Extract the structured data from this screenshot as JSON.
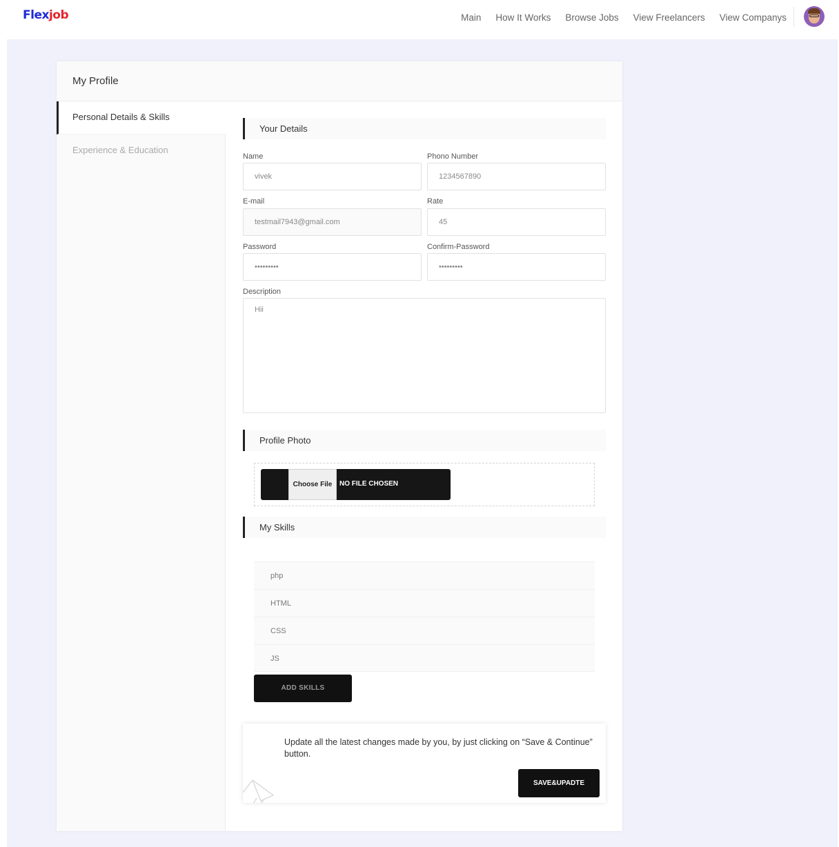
{
  "brand": {
    "part1": "Flex",
    "part2": "job"
  },
  "nav": [
    {
      "label": "Main"
    },
    {
      "label": "How It Works"
    },
    {
      "label": "Browse Jobs"
    },
    {
      "label": "View Freelancers"
    },
    {
      "label": "View Companys"
    }
  ],
  "card": {
    "title": "My Profile"
  },
  "sidebar": {
    "items": [
      {
        "label": "Personal Details & Skills"
      },
      {
        "label": "Experience & Education"
      }
    ]
  },
  "details": {
    "heading": "Your Details",
    "name": {
      "label": "Name",
      "value": "vivek"
    },
    "phone": {
      "label": "Phono Number",
      "value": "1234567890"
    },
    "email": {
      "label": "E-mail",
      "value": "testmail7943@gmail.com"
    },
    "rate": {
      "label": "Rate",
      "value": "45"
    },
    "password": {
      "label": "Password",
      "value": "•••••••••"
    },
    "confirm_password": {
      "label": "Confirm-Password",
      "value": "•••••••••"
    },
    "description": {
      "label": "Description",
      "value": "Hii"
    }
  },
  "photo": {
    "heading": "Profile Photo",
    "choose_label": "Choose File",
    "status": "NO FILE CHOSEN"
  },
  "skills": {
    "heading": "My Skills",
    "items": [
      "php",
      "HTML",
      "CSS",
      "JS"
    ],
    "add_label": "ADD SKILLS"
  },
  "notice": {
    "text": "Update all the latest changes made by you, by just clicking on “Save & Continue” button.",
    "save_label": "SAVE&UPADTE"
  }
}
